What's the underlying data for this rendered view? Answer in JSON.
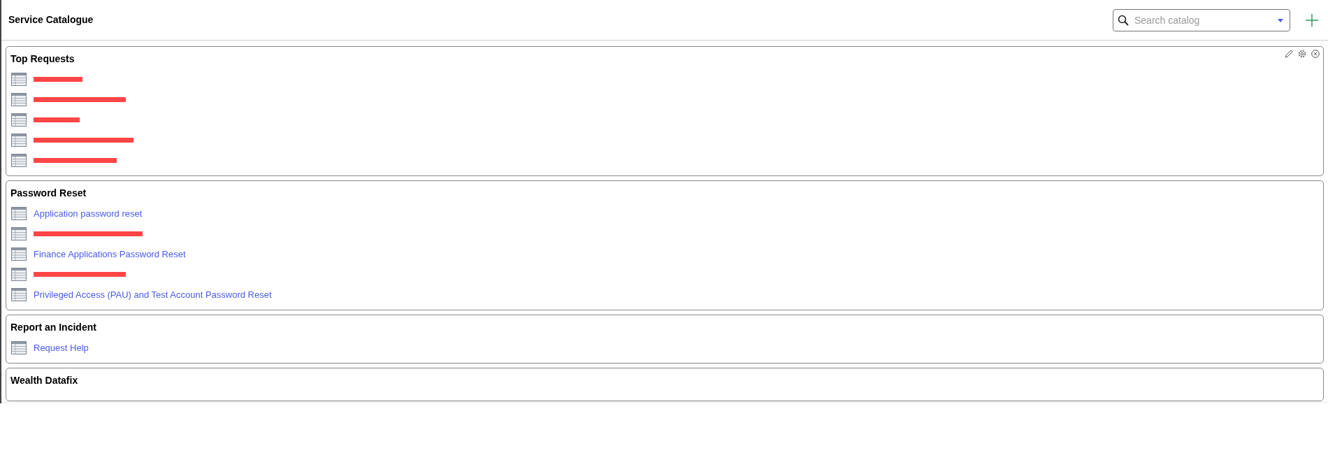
{
  "header": {
    "title": "Service Catalogue",
    "search": {
      "placeholder": "Search catalog"
    }
  },
  "panels": [
    {
      "title": "Top Requests",
      "controls": true,
      "items": [
        {
          "kind": "redacted"
        },
        {
          "kind": "redacted"
        },
        {
          "kind": "redacted"
        },
        {
          "kind": "redacted"
        },
        {
          "kind": "redacted"
        }
      ]
    },
    {
      "title": "Password Reset",
      "controls": false,
      "items": [
        {
          "kind": "link",
          "label": "Application password reset"
        },
        {
          "kind": "redacted"
        },
        {
          "kind": "link",
          "label": "Finance Applications Password Reset"
        },
        {
          "kind": "redacted"
        },
        {
          "kind": "link",
          "label": "Privileged Access (PAU) and Test Account Password Reset"
        }
      ]
    },
    {
      "title": "Report an Incident",
      "controls": false,
      "items": [
        {
          "kind": "link",
          "label": "Request Help"
        }
      ]
    },
    {
      "title": "Wealth Datafix",
      "controls": false
    }
  ]
}
